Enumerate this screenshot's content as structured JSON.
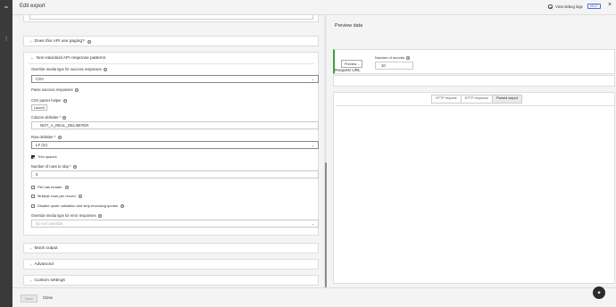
{
  "header": {
    "title": "Edit export",
    "debug_label": "View debug logs",
    "help_label": "HELP"
  },
  "left": {
    "paging_label": "Does this API use paging?",
    "nonstd_label": "Non-standard API response patterns",
    "override_success_label": "Override media type for success responses",
    "override_success_value": "CSV",
    "parse_success_label": "Parse success responses",
    "csv_helper_label": "CSV parser helper",
    "launch_label": "Launch",
    "column_delim_label": "Column delimiter *",
    "column_delim_value": "NOT_A_REAL_DELIMITER",
    "row_delim_label": "Row delimiter *",
    "row_delim_value": "LF (\\n)",
    "trim_spaces_label": "Trim spaces",
    "rows_skip_label": "Number of rows to skip *",
    "rows_skip_value": "0",
    "file_header_label": "File has header",
    "multi_rows_label": "Multiple rows per record",
    "disable_quote_label": "Disable quote validation and strip enclosing quotes",
    "override_error_label": "Override media type for error responses",
    "override_error_placeholder": "Do not override",
    "mock_output_label": "Mock output",
    "advanced_label": "Advanced",
    "custom_settings_label": "Custom settings"
  },
  "right": {
    "preview_title": "Preview data",
    "preview_btn": "Preview",
    "records_label": "Number of records",
    "records_value": "10",
    "request_url_label": "Request URL",
    "tabs": [
      "HTTP request",
      "HTTP response",
      "Parsed output"
    ],
    "active_tab": "Parsed output"
  },
  "footer": {
    "save_label": "Save",
    "close_label": "Close"
  }
}
